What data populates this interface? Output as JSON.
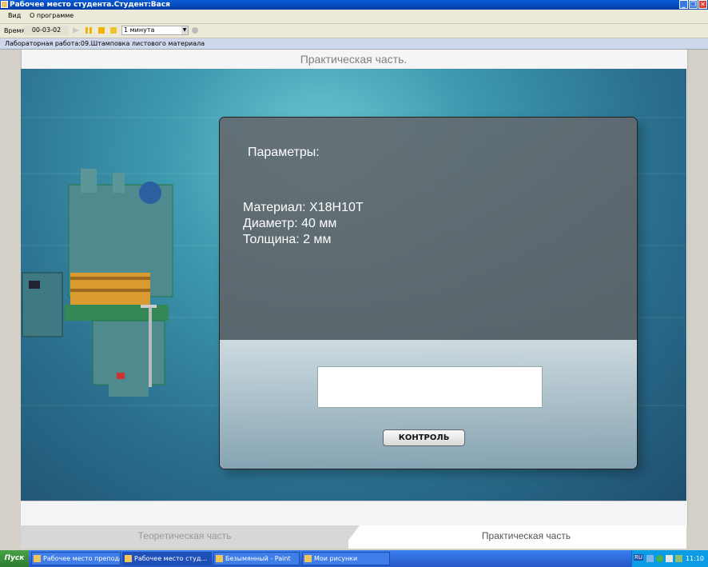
{
  "window": {
    "title": "Рабочее место студента.Студент:Вася",
    "controls": [
      "_",
      "❐",
      "✕"
    ]
  },
  "menu": [
    "Вид",
    "О программе"
  ],
  "toolbar": {
    "time_label": "Время",
    "time_value": "00-03-02",
    "interval_value": "1 минута"
  },
  "lab": {
    "title": "Лабораторная работа:09.Штамповка листового материала"
  },
  "main": {
    "section_title": "Практическая часть."
  },
  "panel": {
    "heading": "Параметры:",
    "material": "Материал:  Х18Н10Т",
    "diameter": "Диаметр:  40 мм",
    "thickness": "Толщина:  2 мм",
    "answer_value": "",
    "control_button": "КОНТРОЛЬ"
  },
  "tabs": {
    "theory": "Теоретическая часть",
    "practice": "Практическая часть"
  },
  "taskbar": {
    "start": "Пуск",
    "tasks": [
      "Рабочее место препода...",
      "Рабочее место студ...",
      "Безымянный - Paint",
      "Мои рисунки"
    ],
    "tray_lang": "RU",
    "clock": "11:10"
  },
  "colors": {
    "titlebar": "#0a5bd6",
    "scene": "#3d9aaf",
    "taskbar": "#2556c7"
  }
}
